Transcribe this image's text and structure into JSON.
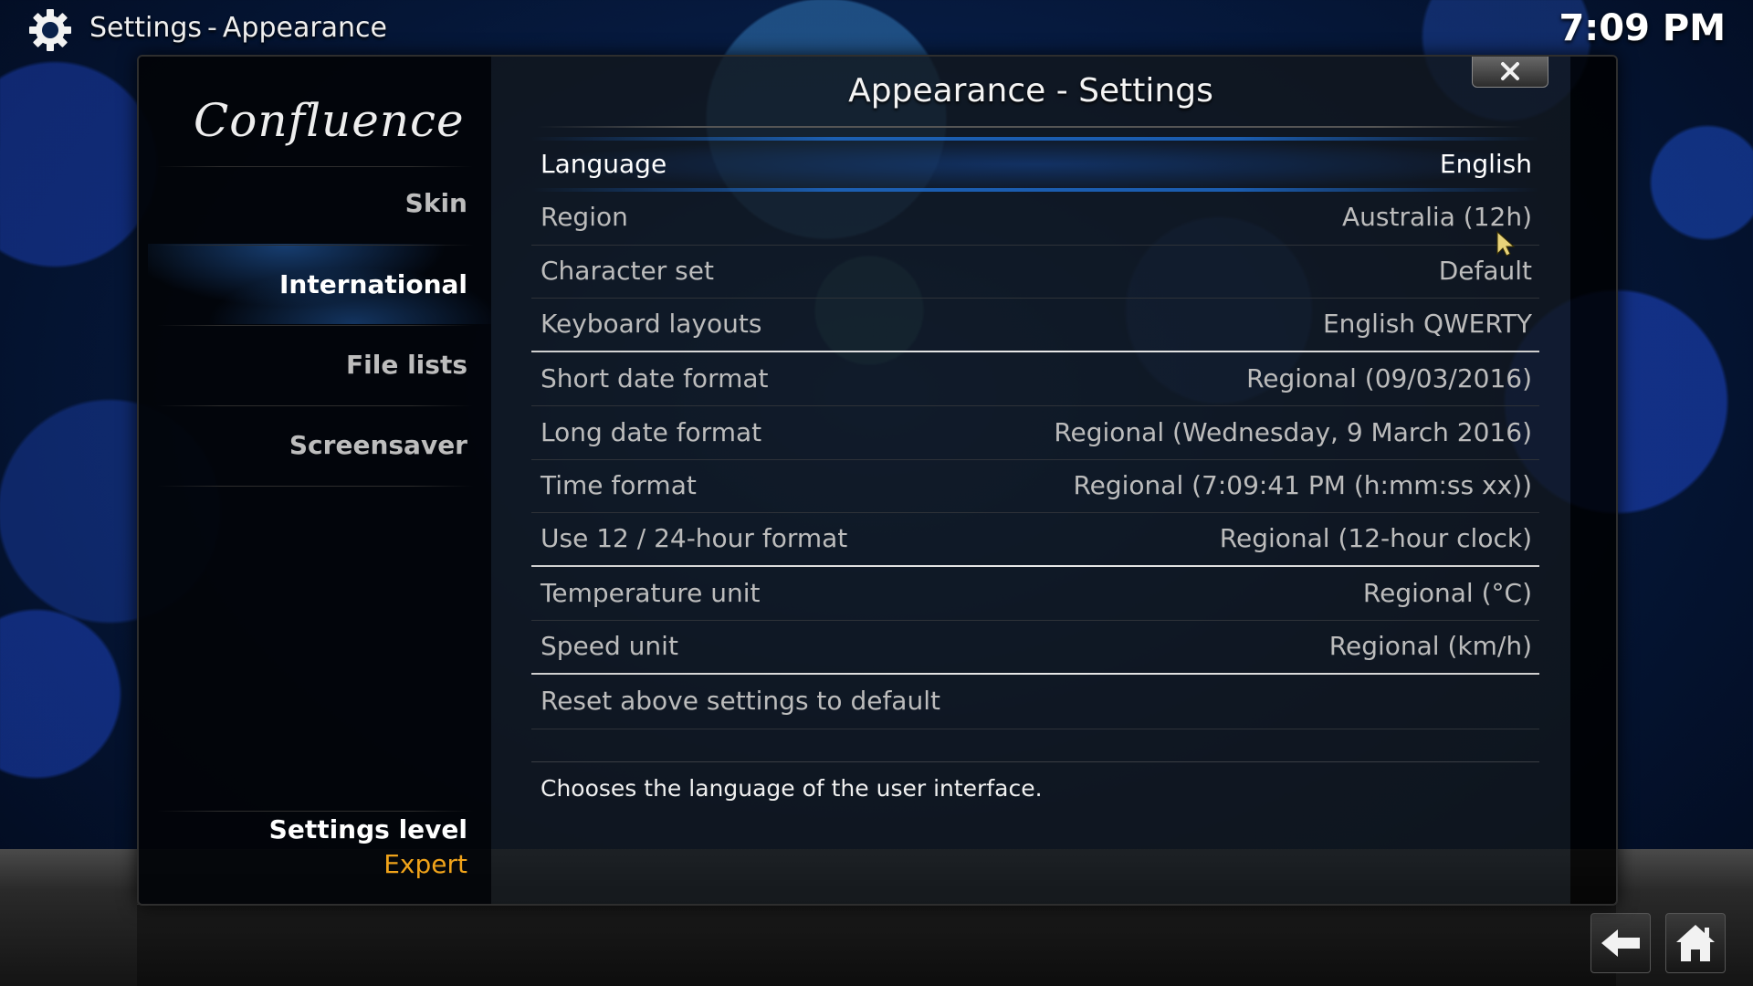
{
  "header": {
    "icon": "gear-icon",
    "title": "Settings",
    "separator": "-",
    "subtitle": "Appearance",
    "clock": "7:09 PM"
  },
  "dialog": {
    "title": "Appearance - Settings",
    "close_icon": "close-icon"
  },
  "sidebar": {
    "logo": "Confluence",
    "items": [
      {
        "label": "Skin"
      },
      {
        "label": "International"
      },
      {
        "label": "File lists"
      },
      {
        "label": "Screensaver"
      }
    ],
    "selected_index": 1,
    "settings_level_label": "Settings level",
    "settings_level_value": "Expert"
  },
  "settings": [
    {
      "label": "Language",
      "value": "English"
    },
    {
      "label": "Region",
      "value": "Australia (12h)"
    },
    {
      "label": "Character set",
      "value": "Default"
    },
    {
      "label": "Keyboard layouts",
      "value": "English QWERTY"
    },
    {
      "label": "Short date format",
      "value": "Regional (09/03/2016)"
    },
    {
      "label": "Long date format",
      "value": "Regional (Wednesday, 9 March 2016)"
    },
    {
      "label": "Time format",
      "value": "Regional (7:09:41 PM (h:mm:ss xx))"
    },
    {
      "label": "Use 12 / 24-hour format",
      "value": "Regional (12-hour clock)"
    },
    {
      "label": "Temperature unit",
      "value": "Regional (°C)"
    },
    {
      "label": "Speed unit",
      "value": "Regional (km/h)"
    },
    {
      "label": "Reset above settings to default",
      "value": ""
    }
  ],
  "focused_setting_index": 0,
  "description": "Chooses the language of the user interface.",
  "footer": {
    "back_icon": "back-arrow-icon",
    "home_icon": "home-icon"
  },
  "colors": {
    "accent_highlight": "#1e6ed2",
    "settings_level_value": "#f0a31a"
  }
}
